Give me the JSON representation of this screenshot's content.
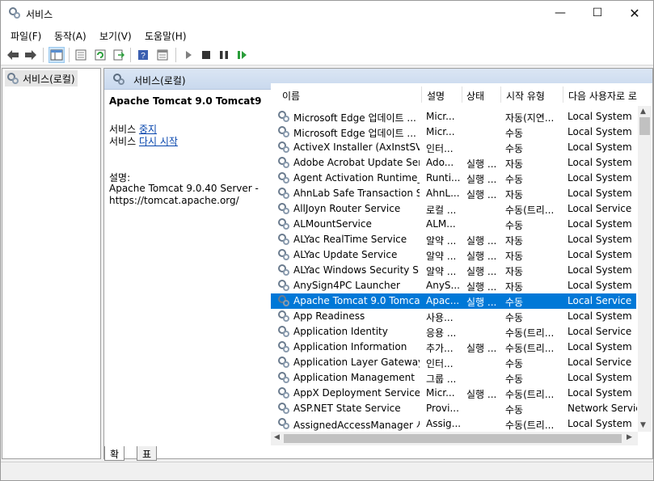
{
  "window": {
    "title": "서비스"
  },
  "menu": [
    "파일(F)",
    "동작(A)",
    "보기(V)",
    "도움말(H)"
  ],
  "toolbar_icons": [
    "back-arrow-icon",
    "forward-arrow-icon",
    "show-hide-tree-icon",
    "properties-icon",
    "refresh-icon",
    "export-list-icon",
    "help-icon",
    "view-icon",
    "play-icon",
    "stop-icon",
    "pause-icon",
    "resume-icon"
  ],
  "tree": {
    "root_label": "서비스(로컬)"
  },
  "header": {
    "title": "서비스(로컬)"
  },
  "details": {
    "service_name": "Apache Tomcat 9.0 Tomcat9",
    "stop_prefix": "서비스",
    "stop_link": "중지",
    "restart_prefix": "서비스",
    "restart_link": "다시 시작",
    "description_label": "설명:",
    "description_line1": "Apache Tomcat 9.0.40 Server -",
    "description_line2": "https://tomcat.apache.org/"
  },
  "columns": [
    "이름",
    "설명",
    "상태",
    "시작 유형",
    "다음 사용자로 로"
  ],
  "services": [
    {
      "name": "Microsoft Edge 업데이트 ...",
      "desc": "Micr...",
      "status": "",
      "start": "자동(지연...",
      "logon": "Local System"
    },
    {
      "name": "Microsoft Edge 업데이트 ...",
      "desc": "Micr...",
      "status": "",
      "start": "수동",
      "logon": "Local System"
    },
    {
      "name": "ActiveX Installer (AxInstSV)",
      "desc": "인터...",
      "status": "",
      "start": "수동",
      "logon": "Local System"
    },
    {
      "name": "Adobe Acrobat Update Ser...",
      "desc": "Ado...",
      "status": "실행 ...",
      "start": "자동",
      "logon": "Local System"
    },
    {
      "name": "Agent Activation Runtime_...",
      "desc": "Runti...",
      "status": "실행 ...",
      "start": "수동",
      "logon": "Local System"
    },
    {
      "name": "AhnLab Safe Transaction S...",
      "desc": "AhnL...",
      "status": "실행 ...",
      "start": "자동",
      "logon": "Local System"
    },
    {
      "name": "AllJoyn Router Service",
      "desc": "로컬 ...",
      "status": "",
      "start": "수동(트리...",
      "logon": "Local Service"
    },
    {
      "name": "ALMountService",
      "desc": "ALM...",
      "status": "",
      "start": "수동",
      "logon": "Local System"
    },
    {
      "name": "ALYac RealTime Service",
      "desc": "알약 ...",
      "status": "실행 ...",
      "start": "자동",
      "logon": "Local System"
    },
    {
      "name": "ALYac Update Service",
      "desc": "알약 ...",
      "status": "실행 ...",
      "start": "자동",
      "logon": "Local System"
    },
    {
      "name": "ALYac Windows Security S...",
      "desc": "알약 ...",
      "status": "실행 ...",
      "start": "자동",
      "logon": "Local System"
    },
    {
      "name": "AnySign4PC Launcher",
      "desc": "AnyS...",
      "status": "실행 ...",
      "start": "자동",
      "logon": "Local System"
    },
    {
      "name": "Apache Tomcat 9.0 Tomcat9",
      "desc": "Apac...",
      "status": "실행 ...",
      "start": "수동",
      "logon": "Local Service",
      "selected": true
    },
    {
      "name": "App Readiness",
      "desc": "사용...",
      "status": "",
      "start": "수동",
      "logon": "Local System"
    },
    {
      "name": "Application Identity",
      "desc": "응용 ...",
      "status": "",
      "start": "수동(트리...",
      "logon": "Local Service"
    },
    {
      "name": "Application Information",
      "desc": "추가...",
      "status": "실행 ...",
      "start": "수동(트리...",
      "logon": "Local System"
    },
    {
      "name": "Application Layer Gateway ...",
      "desc": "인터...",
      "status": "",
      "start": "수동",
      "logon": "Local Service"
    },
    {
      "name": "Application Management",
      "desc": "그룹 ...",
      "status": "",
      "start": "수동",
      "logon": "Local System"
    },
    {
      "name": "AppX Deployment Service ...",
      "desc": "Micr...",
      "status": "실행 ...",
      "start": "수동(트리...",
      "logon": "Local System"
    },
    {
      "name": "ASP.NET State Service",
      "desc": "Provi...",
      "status": "",
      "start": "수동",
      "logon": "Network Service"
    },
    {
      "name": "AssignedAccessManager 서...",
      "desc": "Assig...",
      "status": "",
      "start": "수동(트리...",
      "logon": "Local System"
    }
  ],
  "tabs": [
    "확장",
    "표준"
  ],
  "colors": {
    "selection": "#0078d7",
    "header_gradient_top": "#dbe6f4",
    "header_gradient_bottom": "#c9d9ee",
    "link": "#0645ad"
  }
}
